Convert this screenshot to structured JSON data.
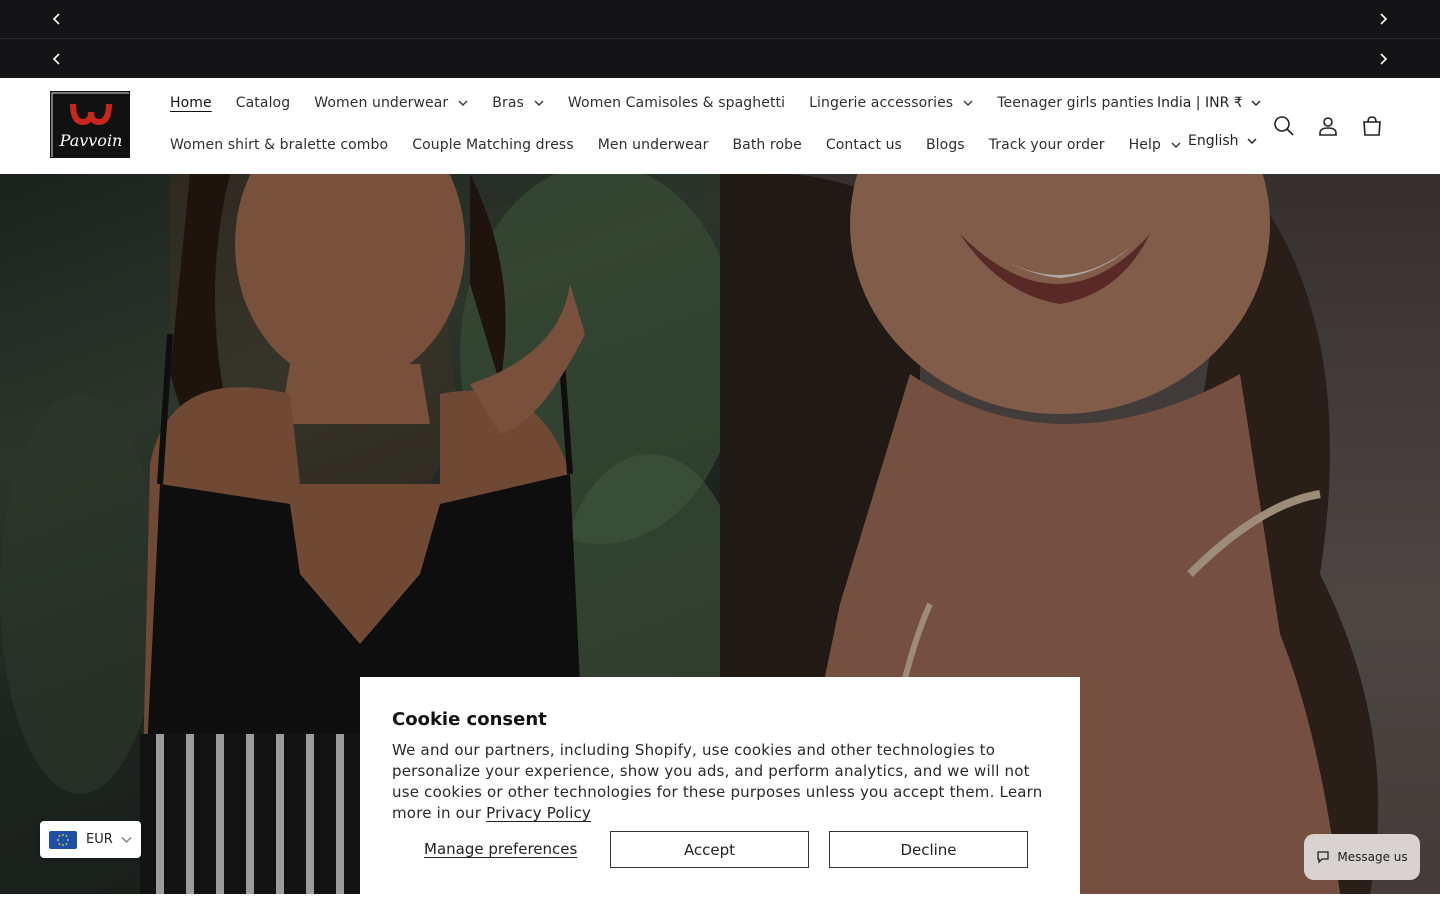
{
  "colors": {
    "announcement_bg": "#141416",
    "text": "#2f2f2f",
    "overlay": "rgba(0,0,0,0.28)",
    "logo_red": "#c8261d",
    "chat_bg": "#d8d2d0"
  },
  "announcement": {
    "prev_icon": "chevron-left-icon",
    "next_icon": "chevron-right-icon"
  },
  "brand": {
    "logo_text": "Pavvoin"
  },
  "nav": {
    "row1": [
      {
        "label": "Home",
        "active": true,
        "dropdown": false
      },
      {
        "label": "Catalog",
        "dropdown": false
      },
      {
        "label": "Women underwear",
        "dropdown": true
      },
      {
        "label": "Bras",
        "dropdown": true
      },
      {
        "label": "Women Camisoles & spaghetti",
        "dropdown": false
      },
      {
        "label": "Lingerie accessories",
        "dropdown": true
      },
      {
        "label": "Teenager girls panties",
        "dropdown": false
      }
    ],
    "row2": [
      {
        "label": "Women shirt & bralette combo",
        "dropdown": false
      },
      {
        "label": "Couple Matching dress",
        "dropdown": false
      },
      {
        "label": "Men underwear",
        "dropdown": false
      },
      {
        "label": "Bath robe",
        "dropdown": false
      },
      {
        "label": "Contact us",
        "dropdown": false
      },
      {
        "label": "Blogs",
        "dropdown": false
      },
      {
        "label": "Track your order",
        "dropdown": false
      },
      {
        "label": "Help",
        "dropdown": true
      }
    ]
  },
  "localization": {
    "country": "India | INR ₹",
    "language": "English"
  },
  "header_icons": [
    "search-icon",
    "account-icon",
    "cart-icon"
  ],
  "cookie": {
    "title": "Cookie consent",
    "body": "We and our partners, including Shopify, use cookies and other technologies to personalize your experience, show you ads, and perform analytics, and we will not use cookies or other technologies for these purposes unless you accept them. Learn more in our ",
    "link": "Privacy Policy",
    "manage": "Manage preferences",
    "accept": "Accept",
    "decline": "Decline"
  },
  "currency_selector": {
    "code": "EUR",
    "flag": "eu-flag-icon"
  },
  "chat": {
    "label": "Message us",
    "icon": "chat-bubble-icon"
  }
}
